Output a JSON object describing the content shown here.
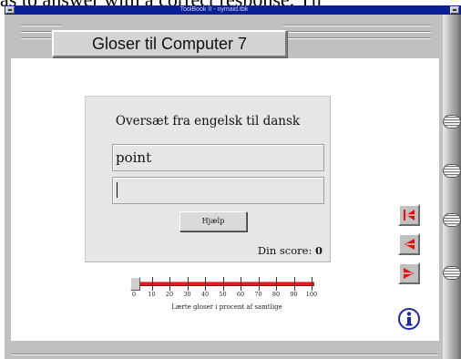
{
  "caption": {
    "text": "as to answer with a correct response. Th"
  },
  "window": {
    "title": "ToolBook II - nymaid.tbk"
  },
  "header": {
    "title": "Gloser til Computer 7"
  },
  "quiz": {
    "prompt": "Oversæt fra engelsk til dansk",
    "word": "point",
    "answer_value": "",
    "help_label": "Hjælp",
    "score_label": "Din score:",
    "score_value": "0"
  },
  "progress": {
    "value_percent": 0,
    "ticks": [
      "0",
      "10",
      "20",
      "30",
      "40",
      "50",
      "60",
      "70",
      "80",
      "90",
      "100"
    ],
    "caption": "Lærte gloser i procent af samtlige",
    "fill_color": "#e02020"
  },
  "navigation": {
    "icons": [
      "first-page-icon",
      "previous-page-icon",
      "next-page-icon",
      "info-icon"
    ],
    "accent_color": "#e01010",
    "info_color": "#1e2a9c"
  }
}
